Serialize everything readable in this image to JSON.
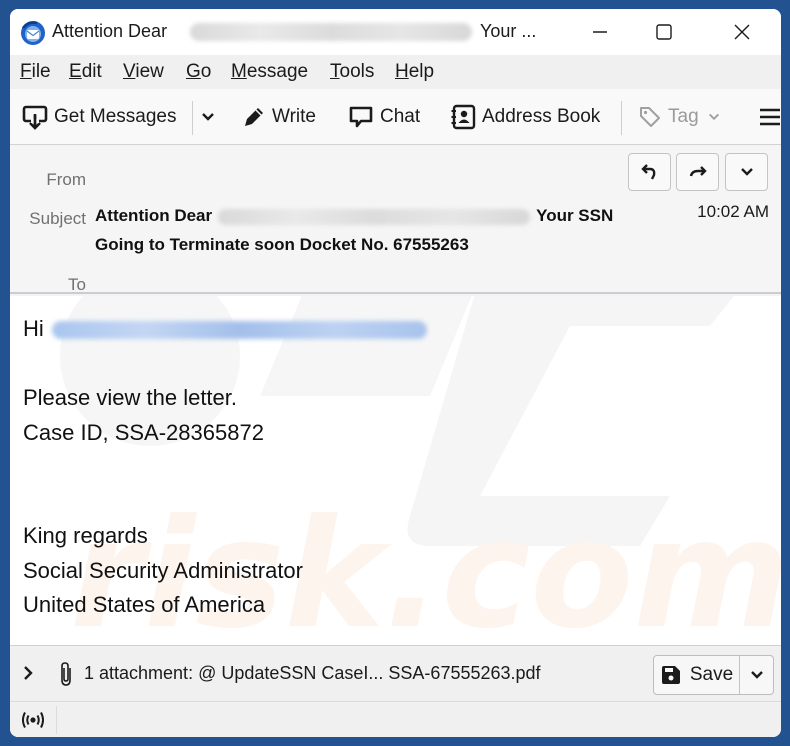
{
  "window": {
    "title_prefix": "Attention Dear",
    "title_suffix": "Your ...",
    "controls": {
      "minimize": "minimize",
      "maximize": "maximize",
      "close": "close"
    }
  },
  "menubar": {
    "items": [
      {
        "accel": "F",
        "rest": "ile"
      },
      {
        "accel": "E",
        "rest": "dit"
      },
      {
        "accel": "V",
        "rest": "iew"
      },
      {
        "accel": "G",
        "rest": "o"
      },
      {
        "accel": "M",
        "rest": "essage"
      },
      {
        "accel": "T",
        "rest": "ools"
      },
      {
        "accel": "H",
        "rest": "elp"
      }
    ]
  },
  "toolbar": {
    "get_messages": "Get Messages",
    "write": "Write",
    "chat": "Chat",
    "address_book": "Address Book",
    "tag": "Tag"
  },
  "header": {
    "from_label": "From",
    "subject_label": "Subject",
    "to_label": "To",
    "subject_prefix": "Attention Dear",
    "subject_mid": "Your SSN",
    "subject_line2": "Going to Terminate soon Docket No. 67555263",
    "time": "10:02 AM"
  },
  "body": {
    "greeting": "Hi",
    "lines": [
      "Please view the letter.",
      "Case ID, SSA-28365872",
      "",
      "",
      "King regards",
      "Social Security Administrator",
      "United States of America"
    ]
  },
  "attachment": {
    "summary": "1 attachment: @ UpdateSSN CaseI... SSA-67555263.pdf",
    "save_label": "Save"
  },
  "colors": {
    "desktop": "#22528f",
    "link_blur": "#aac6ee"
  }
}
